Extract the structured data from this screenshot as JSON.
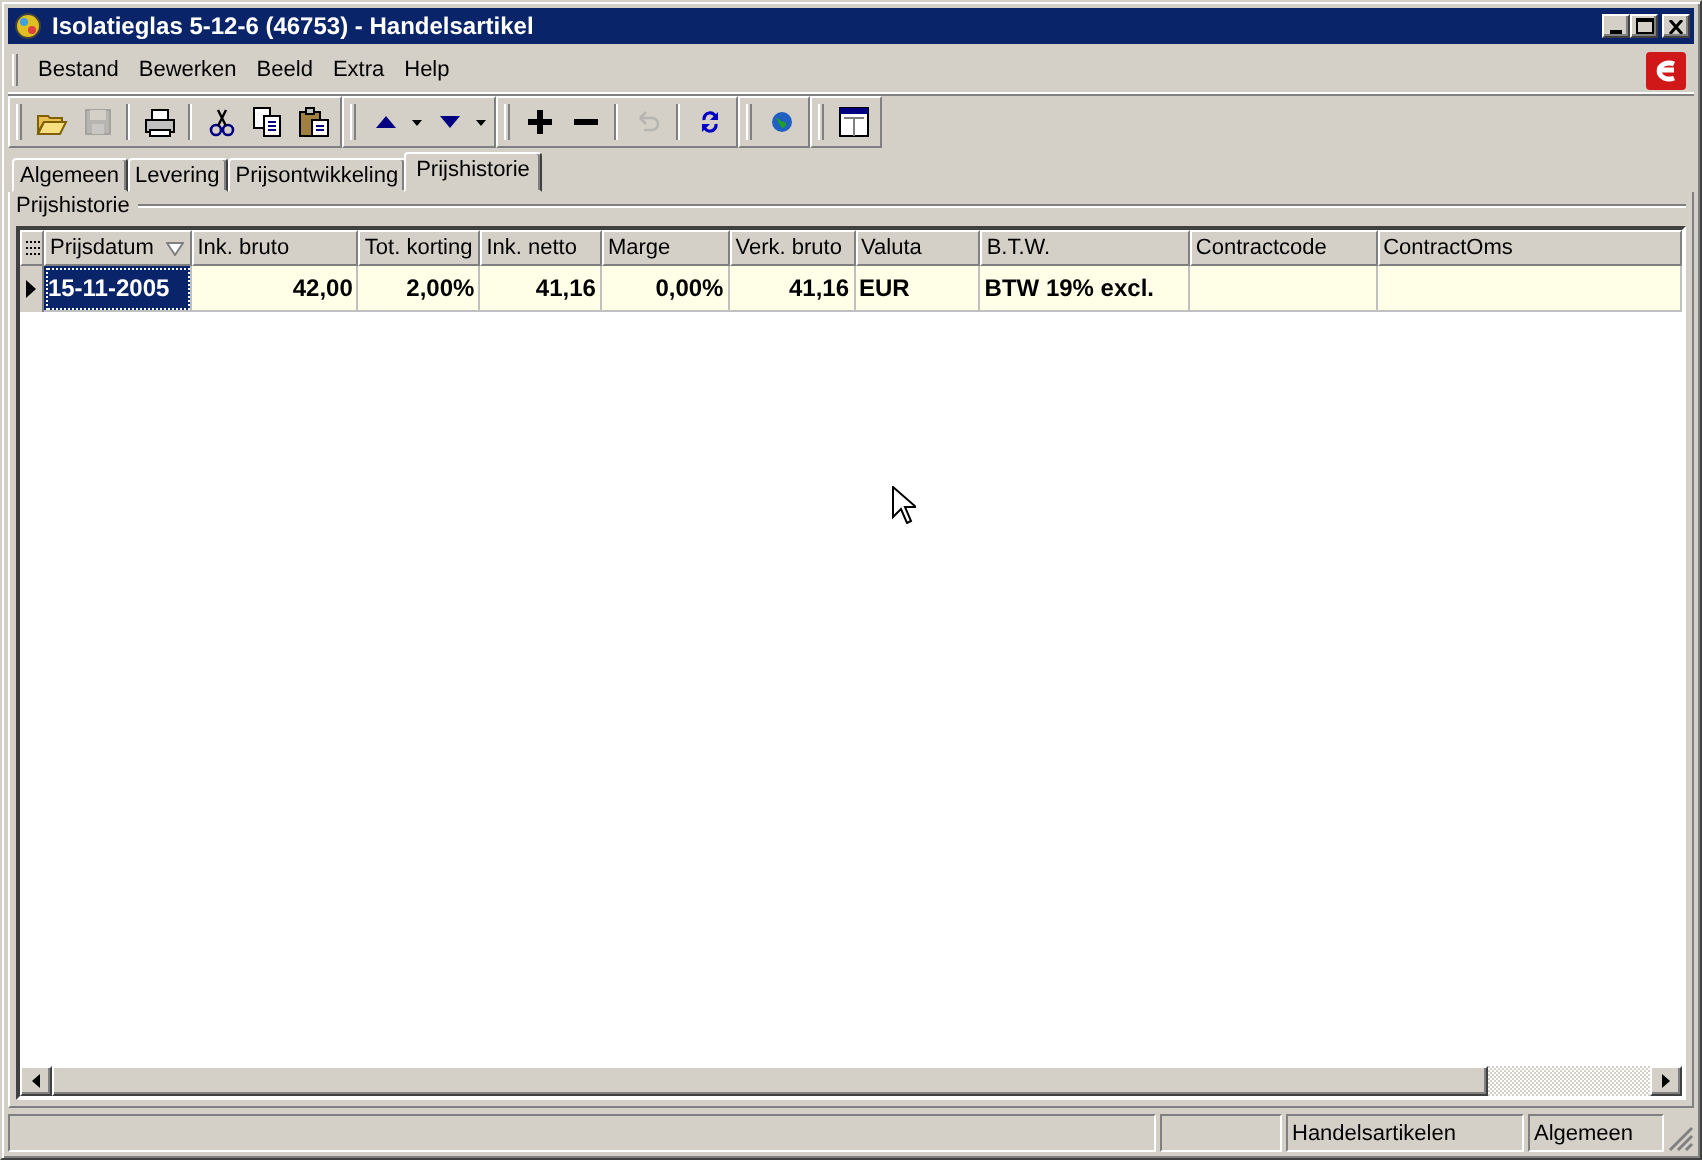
{
  "window": {
    "title": "Isolatieglas 5-12-6 (46753) - Handelsartikel"
  },
  "menu": [
    "Bestand",
    "Bewerken",
    "Beeld",
    "Extra",
    "Help"
  ],
  "toolbar": [
    [
      {
        "kind": "open",
        "disabled": false
      },
      {
        "kind": "save",
        "disabled": true
      },
      {
        "kind": "print",
        "disabled": false
      },
      {
        "kind": "cut",
        "disabled": false
      },
      {
        "kind": "copy",
        "disabled": false
      },
      {
        "kind": "paste",
        "disabled": false
      }
    ],
    [
      {
        "kind": "up",
        "disabled": false
      },
      {
        "kind": "down",
        "disabled": false
      }
    ],
    [
      {
        "kind": "add",
        "disabled": false
      },
      {
        "kind": "remove",
        "disabled": false
      },
      {
        "kind": "undo",
        "disabled": true
      },
      {
        "kind": "refresh",
        "disabled": false
      }
    ],
    [
      {
        "kind": "globe",
        "disabled": false
      }
    ],
    [
      {
        "kind": "layout",
        "disabled": false
      }
    ]
  ],
  "tabs": [
    {
      "label": "Algemeen",
      "selected": false
    },
    {
      "label": "Levering",
      "selected": false
    },
    {
      "label": "Prijsontwikkeling",
      "selected": false
    },
    {
      "label": "Prijshistorie",
      "selected": true
    }
  ],
  "group": {
    "title": "Prijshistorie"
  },
  "grid": {
    "columns": [
      {
        "label": "Prijsdatum",
        "sorted": true
      },
      {
        "label": "Ink. bruto",
        "numeric": true,
        "sorted": false
      },
      {
        "label": "Tot. korting",
        "numeric": true,
        "sorted": false
      },
      {
        "label": "Ink. netto",
        "numeric": true,
        "sorted": false
      },
      {
        "label": "Marge",
        "numeric": true,
        "sorted": false
      },
      {
        "label": "Verk. bruto",
        "numeric": true,
        "sorted": false
      },
      {
        "label": "Valuta",
        "numeric": false,
        "sorted": false
      },
      {
        "label": "B.T.W.",
        "numeric": false,
        "sorted": false
      },
      {
        "label": "Contractcode",
        "sorted": false
      },
      {
        "label": "ContractOms",
        "sorted": false
      }
    ],
    "rows": [
      {
        "selected": true,
        "cells": [
          "15-11-2005",
          "42,00",
          "2,00%",
          "41,16",
          "0,00%",
          "41,16",
          "EUR",
          "BTW 19% excl."
        ]
      }
    ]
  },
  "status_bar": {
    "panels": [
      "Handelsartikelen",
      "Algemeen"
    ]
  }
}
